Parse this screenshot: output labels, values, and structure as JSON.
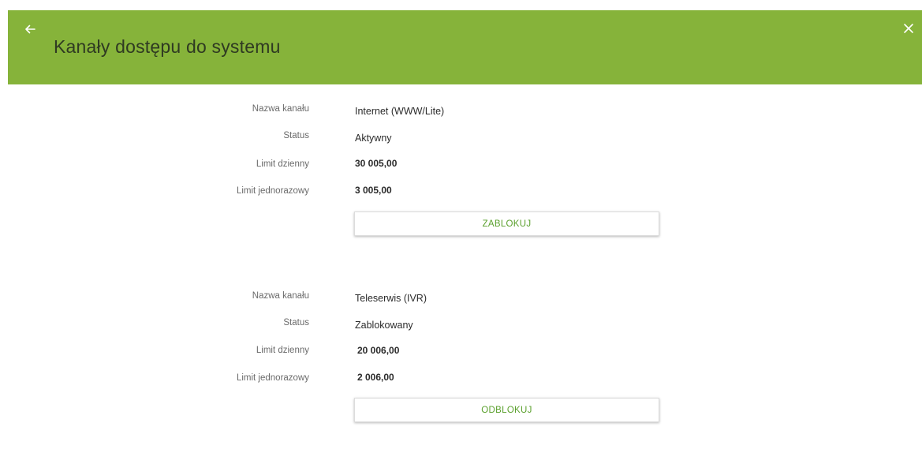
{
  "header": {
    "title": "Kanały dostępu do systemu",
    "back_icon": "arrow-left-icon",
    "close_icon": "close-icon",
    "background_color": "#86b33a"
  },
  "channels": [
    {
      "name_label": "Nazwa kanału",
      "name_value": "Internet (WWW/Lite)",
      "status_label": "Status",
      "status_value": "Aktywny",
      "daily_limit_label": "Limit dzienny",
      "daily_limit_value": "30 005,00",
      "single_limit_label": "Limit jednorazowy",
      "single_limit_value": "3 005,00",
      "action_label": "ZABLOKUJ"
    },
    {
      "name_label": "Nazwa kanału",
      "name_value": "Teleserwis (IVR)",
      "status_label": "Status",
      "status_value": "Zablokowany",
      "daily_limit_label": "Limit dzienny",
      "daily_limit_value": "20 006,00",
      "single_limit_label": "Limit jednorazowy",
      "single_limit_value": "2 006,00",
      "action_label": "ODBLOKUJ"
    }
  ],
  "accent_color": "#5aa02c"
}
